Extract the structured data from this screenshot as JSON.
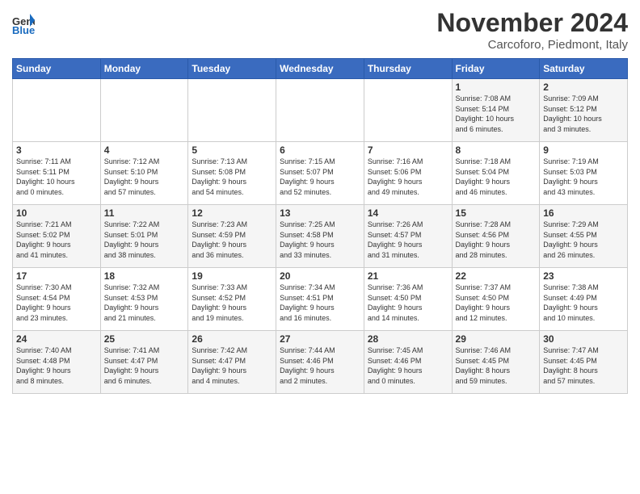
{
  "header": {
    "logo_line1": "General",
    "logo_line2": "Blue",
    "month": "November 2024",
    "location": "Carcoforo, Piedmont, Italy"
  },
  "weekdays": [
    "Sunday",
    "Monday",
    "Tuesday",
    "Wednesday",
    "Thursday",
    "Friday",
    "Saturday"
  ],
  "weeks": [
    [
      {
        "day": "",
        "info": ""
      },
      {
        "day": "",
        "info": ""
      },
      {
        "day": "",
        "info": ""
      },
      {
        "day": "",
        "info": ""
      },
      {
        "day": "",
        "info": ""
      },
      {
        "day": "1",
        "info": "Sunrise: 7:08 AM\nSunset: 5:14 PM\nDaylight: 10 hours\nand 6 minutes."
      },
      {
        "day": "2",
        "info": "Sunrise: 7:09 AM\nSunset: 5:12 PM\nDaylight: 10 hours\nand 3 minutes."
      }
    ],
    [
      {
        "day": "3",
        "info": "Sunrise: 7:11 AM\nSunset: 5:11 PM\nDaylight: 10 hours\nand 0 minutes."
      },
      {
        "day": "4",
        "info": "Sunrise: 7:12 AM\nSunset: 5:10 PM\nDaylight: 9 hours\nand 57 minutes."
      },
      {
        "day": "5",
        "info": "Sunrise: 7:13 AM\nSunset: 5:08 PM\nDaylight: 9 hours\nand 54 minutes."
      },
      {
        "day": "6",
        "info": "Sunrise: 7:15 AM\nSunset: 5:07 PM\nDaylight: 9 hours\nand 52 minutes."
      },
      {
        "day": "7",
        "info": "Sunrise: 7:16 AM\nSunset: 5:06 PM\nDaylight: 9 hours\nand 49 minutes."
      },
      {
        "day": "8",
        "info": "Sunrise: 7:18 AM\nSunset: 5:04 PM\nDaylight: 9 hours\nand 46 minutes."
      },
      {
        "day": "9",
        "info": "Sunrise: 7:19 AM\nSunset: 5:03 PM\nDaylight: 9 hours\nand 43 minutes."
      }
    ],
    [
      {
        "day": "10",
        "info": "Sunrise: 7:21 AM\nSunset: 5:02 PM\nDaylight: 9 hours\nand 41 minutes."
      },
      {
        "day": "11",
        "info": "Sunrise: 7:22 AM\nSunset: 5:01 PM\nDaylight: 9 hours\nand 38 minutes."
      },
      {
        "day": "12",
        "info": "Sunrise: 7:23 AM\nSunset: 4:59 PM\nDaylight: 9 hours\nand 36 minutes."
      },
      {
        "day": "13",
        "info": "Sunrise: 7:25 AM\nSunset: 4:58 PM\nDaylight: 9 hours\nand 33 minutes."
      },
      {
        "day": "14",
        "info": "Sunrise: 7:26 AM\nSunset: 4:57 PM\nDaylight: 9 hours\nand 31 minutes."
      },
      {
        "day": "15",
        "info": "Sunrise: 7:28 AM\nSunset: 4:56 PM\nDaylight: 9 hours\nand 28 minutes."
      },
      {
        "day": "16",
        "info": "Sunrise: 7:29 AM\nSunset: 4:55 PM\nDaylight: 9 hours\nand 26 minutes."
      }
    ],
    [
      {
        "day": "17",
        "info": "Sunrise: 7:30 AM\nSunset: 4:54 PM\nDaylight: 9 hours\nand 23 minutes."
      },
      {
        "day": "18",
        "info": "Sunrise: 7:32 AM\nSunset: 4:53 PM\nDaylight: 9 hours\nand 21 minutes."
      },
      {
        "day": "19",
        "info": "Sunrise: 7:33 AM\nSunset: 4:52 PM\nDaylight: 9 hours\nand 19 minutes."
      },
      {
        "day": "20",
        "info": "Sunrise: 7:34 AM\nSunset: 4:51 PM\nDaylight: 9 hours\nand 16 minutes."
      },
      {
        "day": "21",
        "info": "Sunrise: 7:36 AM\nSunset: 4:50 PM\nDaylight: 9 hours\nand 14 minutes."
      },
      {
        "day": "22",
        "info": "Sunrise: 7:37 AM\nSunset: 4:50 PM\nDaylight: 9 hours\nand 12 minutes."
      },
      {
        "day": "23",
        "info": "Sunrise: 7:38 AM\nSunset: 4:49 PM\nDaylight: 9 hours\nand 10 minutes."
      }
    ],
    [
      {
        "day": "24",
        "info": "Sunrise: 7:40 AM\nSunset: 4:48 PM\nDaylight: 9 hours\nand 8 minutes."
      },
      {
        "day": "25",
        "info": "Sunrise: 7:41 AM\nSunset: 4:47 PM\nDaylight: 9 hours\nand 6 minutes."
      },
      {
        "day": "26",
        "info": "Sunrise: 7:42 AM\nSunset: 4:47 PM\nDaylight: 9 hours\nand 4 minutes."
      },
      {
        "day": "27",
        "info": "Sunrise: 7:44 AM\nSunset: 4:46 PM\nDaylight: 9 hours\nand 2 minutes."
      },
      {
        "day": "28",
        "info": "Sunrise: 7:45 AM\nSunset: 4:46 PM\nDaylight: 9 hours\nand 0 minutes."
      },
      {
        "day": "29",
        "info": "Sunrise: 7:46 AM\nSunset: 4:45 PM\nDaylight: 8 hours\nand 59 minutes."
      },
      {
        "day": "30",
        "info": "Sunrise: 7:47 AM\nSunset: 4:45 PM\nDaylight: 8 hours\nand 57 minutes."
      }
    ]
  ]
}
